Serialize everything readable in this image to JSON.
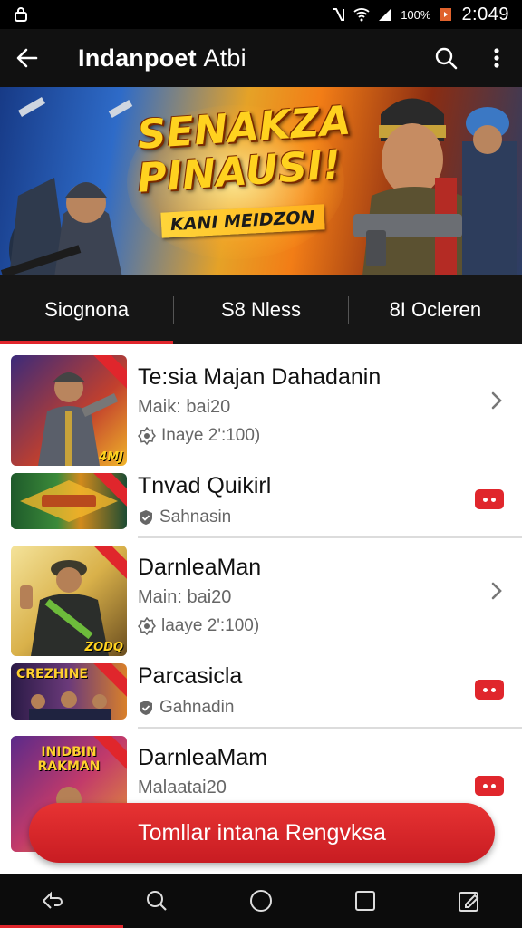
{
  "status_bar": {
    "battery": "100%",
    "time": "2:049"
  },
  "app_bar": {
    "title": "Indanpoet",
    "title_suffix": "Atbi"
  },
  "banner": {
    "headline_line1": "SENAKZA",
    "headline_line2": "PINAUSI!",
    "tagline": "KANI MEIDZON"
  },
  "tabs": [
    {
      "label": "Siognona",
      "active": true
    },
    {
      "label": "S8 Nless",
      "active": false
    },
    {
      "label": "8I Ocleren",
      "active": false
    }
  ],
  "list": {
    "entries": [
      {
        "title": "Te:sia Majan Dahadanin",
        "subtitle": "Maik: bai20",
        "meta": "Inaye 2':100)",
        "thumb_text": "4MJ",
        "trailing": "chevron"
      },
      {
        "title": "Tnvad Quikirl",
        "subtitle": "",
        "meta": "Sahnasin",
        "thumb_text": "",
        "trailing": "youtube"
      },
      {
        "title": "DarnleaMan",
        "subtitle": "Main: bai20",
        "meta": "laaye 2':100)",
        "thumb_text": "ZODQ",
        "trailing": "chevron"
      },
      {
        "title": "Parcasicla",
        "subtitle": "",
        "meta": "Gahnadin",
        "thumb_text": "",
        "trailing": "youtube"
      },
      {
        "title": "DarnleaMam",
        "subtitle": "Malaatai20",
        "meta": "",
        "thumb_text": "",
        "trailing": "youtube"
      }
    ],
    "thumb_labels": [
      "",
      "",
      "",
      "CREZHINE",
      "INIDBIN RAKMAN"
    ]
  },
  "fab": {
    "label": "Tomllar intana Rengvksa"
  },
  "colors": {
    "accent": "#e0262c",
    "app_bar": "#111111",
    "tab_bar": "#161616"
  },
  "icons": [
    "lock-icon",
    "back-arrow-icon",
    "search-icon",
    "more-vert-icon",
    "chevron-right-icon",
    "youtube-icon",
    "badge-icon",
    "shield-check-icon",
    "nav-back-icon",
    "nav-search-icon",
    "nav-home-icon",
    "nav-recents-icon",
    "nav-edit-icon"
  ]
}
